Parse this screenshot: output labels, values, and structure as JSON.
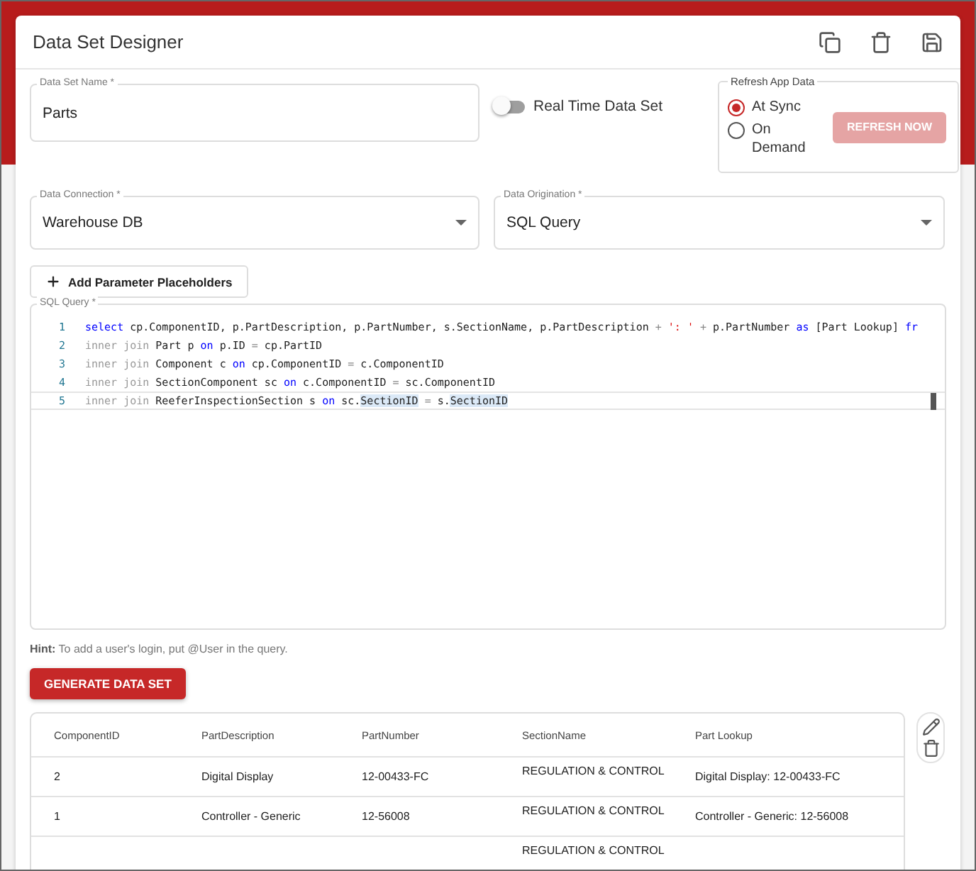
{
  "window": {
    "title": "Data Set Designer"
  },
  "name_field": {
    "label": "Data Set Name *",
    "value": "Parts"
  },
  "real_time": {
    "label": "Real Time Data Set",
    "on": false
  },
  "refresh": {
    "legend": "Refresh App Data",
    "options": [
      {
        "label": "At Sync",
        "selected": true
      },
      {
        "label": "On Demand",
        "selected": false
      }
    ],
    "button": {
      "label": "REFRESH NOW",
      "disabled": true
    }
  },
  "connection": {
    "label": "Data Connection *",
    "value": "Warehouse DB"
  },
  "origination": {
    "label": "Data Origination *",
    "value": "SQL Query"
  },
  "add_params": {
    "label": "Add Parameter Placeholders"
  },
  "sql": {
    "label": "SQL Query *",
    "lines": [
      {
        "number": "1",
        "active": false,
        "tokens": [
          {
            "kind": "keyword",
            "t": "select"
          },
          {
            "kind": "plain",
            "t": " cp.ComponentID, p.PartDescription, p.PartNumber, s.SectionName, p.PartDescription "
          },
          {
            "kind": "operator",
            "t": "+"
          },
          {
            "kind": "string",
            "t": " ': ' "
          },
          {
            "kind": "operator",
            "t": "+"
          },
          {
            "kind": "plain",
            "t": " p.PartNumber "
          },
          {
            "kind": "keyword",
            "t": "as"
          },
          {
            "kind": "plain",
            "t": " [Part Lookup] "
          },
          {
            "kind": "keyword",
            "t": "fr"
          }
        ]
      },
      {
        "number": "2",
        "active": false,
        "tokens": [
          {
            "kind": "muted",
            "t": "inner join"
          },
          {
            "kind": "plain",
            "t": " Part p "
          },
          {
            "kind": "keyword",
            "t": "on"
          },
          {
            "kind": "plain",
            "t": " p.ID "
          },
          {
            "kind": "operator",
            "t": "="
          },
          {
            "kind": "plain",
            "t": " cp.PartID"
          }
        ]
      },
      {
        "number": "3",
        "active": false,
        "tokens": [
          {
            "kind": "muted",
            "t": "inner join"
          },
          {
            "kind": "plain",
            "t": " Component c "
          },
          {
            "kind": "keyword",
            "t": "on"
          },
          {
            "kind": "plain",
            "t": " cp.ComponentID "
          },
          {
            "kind": "operator",
            "t": "="
          },
          {
            "kind": "plain",
            "t": " c.ComponentID"
          }
        ]
      },
      {
        "number": "4",
        "active": false,
        "tokens": [
          {
            "kind": "muted",
            "t": "inner join"
          },
          {
            "kind": "plain",
            "t": " SectionComponent sc "
          },
          {
            "kind": "keyword",
            "t": "on"
          },
          {
            "kind": "plain",
            "t": " c.ComponentID "
          },
          {
            "kind": "operator",
            "t": "="
          },
          {
            "kind": "plain",
            "t": " sc.ComponentID"
          }
        ]
      },
      {
        "number": "5",
        "active": true,
        "tokens": [
          {
            "kind": "muted",
            "t": "inner join"
          },
          {
            "kind": "plain",
            "t": " ReeferInspectionSection s "
          },
          {
            "kind": "keyword",
            "t": "on"
          },
          {
            "kind": "plain",
            "t": " sc."
          },
          {
            "kind": "match",
            "t": "SectionID"
          },
          {
            "kind": "operator",
            "t": " = "
          },
          {
            "kind": "plain",
            "t": "s."
          },
          {
            "kind": "match",
            "t": "SectionID"
          }
        ]
      }
    ]
  },
  "hint": "**Hint:** To add a user's login, put @User in the query.",
  "generate": {
    "label": "GENERATE DATA SET"
  },
  "table": {
    "columns": [
      "ComponentID",
      "PartDescription",
      "PartNumber",
      "SectionName",
      "Part Lookup"
    ],
    "rows": [
      {
        "cells": [
          "2",
          "Digital Display",
          "12-00433-FC",
          "REGULATION & CONTROL",
          "Digital Display: 12-00433-FC"
        ]
      },
      {
        "cells": [
          "1",
          "Controller - Generic",
          "12-56008",
          "REGULATION & CONTROL",
          "Controller - Generic: 12-56008"
        ]
      },
      {
        "cells": [
          null,
          null,
          null,
          "REGULATION & CONTROL",
          null
        ]
      }
    ]
  }
}
